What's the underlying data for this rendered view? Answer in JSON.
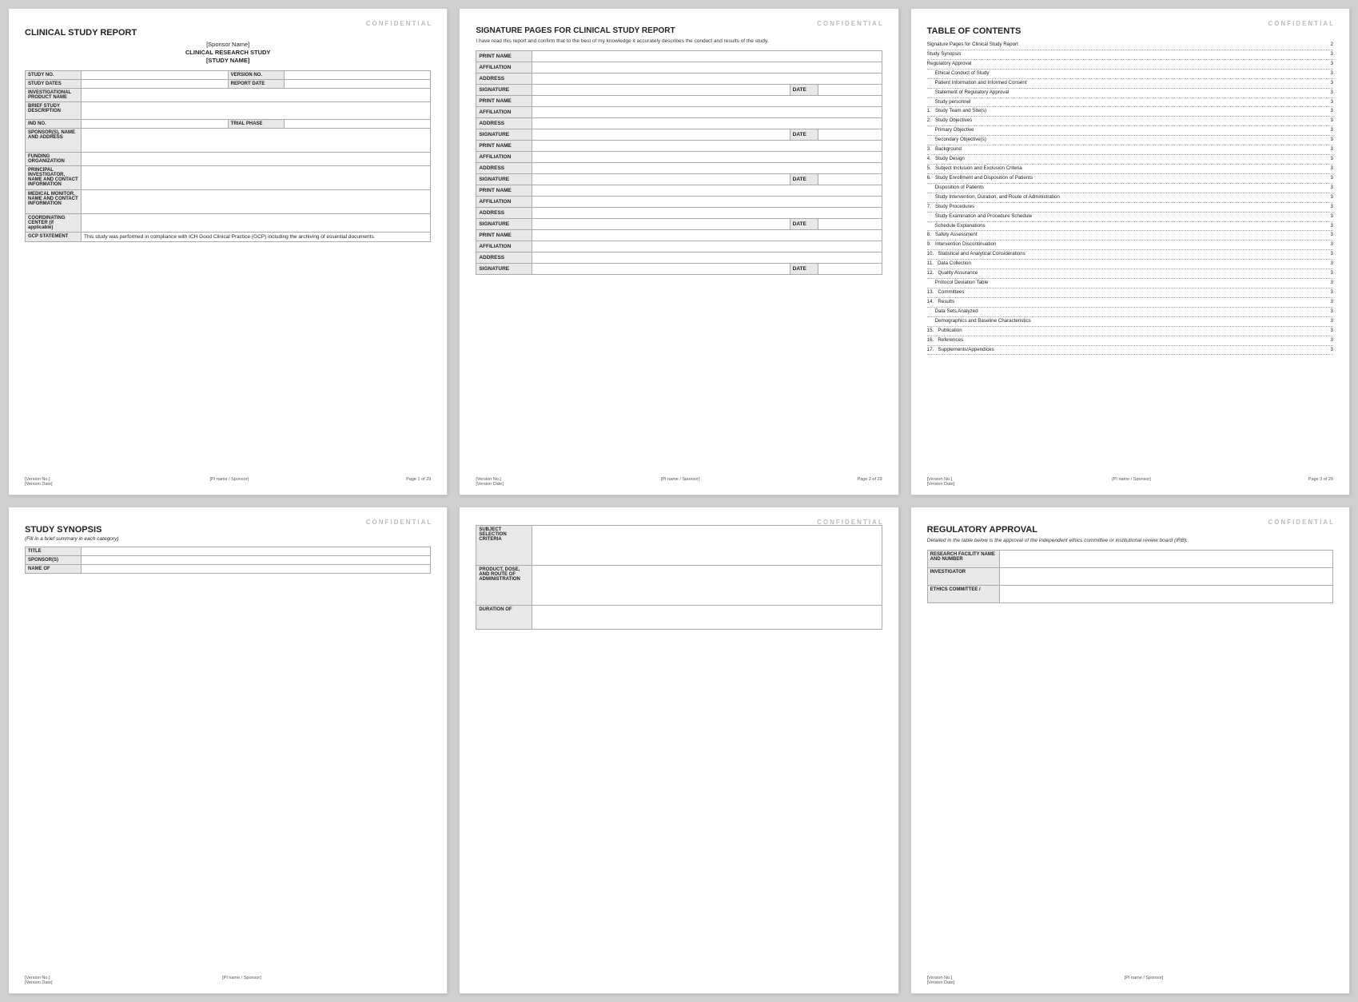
{
  "pages": [
    {
      "id": "page1",
      "confidential": "CONFIDENTIAL",
      "title": "CLINICAL STUDY REPORT",
      "subtitle1": "[Sponsor Name]",
      "subtitle2": "CLINICAL RESEARCH STUDY",
      "subtitle3": "[STUDY NAME]",
      "fields": [
        {
          "label": "STUDY NO.",
          "value": "",
          "colspan": false,
          "extra_label": "VERSION NO.",
          "extra_value": ""
        },
        {
          "label": "STUDY DATES",
          "value": "",
          "colspan": false,
          "extra_label": "REPORT DATE",
          "extra_value": ""
        },
        {
          "label": "INVESTIGATIONAL PRODUCT NAME",
          "value": "",
          "full": true
        },
        {
          "label": "BRIEF STUDY DESCRIPTION",
          "value": "",
          "full": true,
          "tall": true
        },
        {
          "label": "IND NO.",
          "value": "",
          "colspan": false,
          "extra_label": "TRIAL PHASE",
          "extra_value": ""
        },
        {
          "label": "SPONSOR(S), NAME AND ADDRESS",
          "value": "",
          "full": true,
          "taller": true
        },
        {
          "label": "FUNDING ORGANIZATION",
          "value": "",
          "full": true
        },
        {
          "label": "PRINCIPAL INVESTIGATOR, NAME AND CONTACT INFORMATION",
          "value": "",
          "full": true,
          "taller": true
        },
        {
          "label": "MEDICAL MONITOR, NAME AND CONTACT INFORMATION",
          "value": "",
          "full": true,
          "taller": true
        },
        {
          "label": "COORDINATING CENTER (if applicable)",
          "value": "",
          "full": true
        },
        {
          "label": "GCP STATEMENT",
          "value": "This study was performed in compliance with ICH Good Clinical Practice (GCP) including the archiving of essential documents.",
          "full": true
        }
      ],
      "footer": {
        "left": "[Version No.]",
        "left2": "[Version Date]",
        "center": "[PI name / Sponsor]",
        "right": "Page 1 of 29"
      }
    },
    {
      "id": "page2",
      "confidential": "CONFIDENTIAL",
      "title": "SIGNATURE PAGES FOR CLINICAL STUDY REPORT",
      "subtitle": "I have read this report and confirm that to the best of my knowledge it accurately describes the conduct and results of the study.",
      "sig_groups": [
        {
          "rows": [
            {
              "label": "PRINT NAME",
              "value": ""
            },
            {
              "label": "AFFILIATION",
              "value": ""
            },
            {
              "label": "ADDRESS",
              "value": ""
            },
            {
              "label": "SIGNATURE",
              "value": "",
              "has_date": true
            }
          ]
        },
        {
          "rows": [
            {
              "label": "PRINT NAME",
              "value": ""
            },
            {
              "label": "AFFILIATION",
              "value": ""
            },
            {
              "label": "ADDRESS",
              "value": ""
            },
            {
              "label": "SIGNATURE",
              "value": "",
              "has_date": true
            }
          ]
        },
        {
          "rows": [
            {
              "label": "PRINT NAME",
              "value": ""
            },
            {
              "label": "AFFILIATION",
              "value": ""
            },
            {
              "label": "ADDRESS",
              "value": ""
            },
            {
              "label": "SIGNATURE",
              "value": "",
              "has_date": true
            }
          ]
        },
        {
          "rows": [
            {
              "label": "PRINT NAME",
              "value": ""
            },
            {
              "label": "AFFILIATION",
              "value": ""
            },
            {
              "label": "ADDRESS",
              "value": ""
            },
            {
              "label": "SIGNATURE",
              "value": "",
              "has_date": true
            }
          ]
        },
        {
          "rows": [
            {
              "label": "PRINT NAME",
              "value": ""
            },
            {
              "label": "AFFILIATION",
              "value": ""
            },
            {
              "label": "ADDRESS",
              "value": ""
            },
            {
              "label": "SIGNATURE",
              "value": "",
              "has_date": true
            }
          ]
        }
      ],
      "footer": {
        "left": "[Version No.]",
        "left2": "[Version Date]",
        "center": "[PI name / Sponsor]",
        "right": "Page 2 of 29"
      }
    },
    {
      "id": "page3",
      "confidential": "CONFIDENTIAL",
      "title": "TABLE OF CONTENTS",
      "entries": [
        {
          "label": "Signature Pages for Clinical Study Report",
          "page": "2",
          "indent": 0
        },
        {
          "label": "Study Synopsis",
          "page": "3",
          "indent": 0
        },
        {
          "label": "Regulatory Approval",
          "page": "3",
          "indent": 0
        },
        {
          "label": "Ethical Conduct of Study",
          "page": "3",
          "indent": 1
        },
        {
          "label": "Patient Information and Informed Consent",
          "page": "3",
          "indent": 1
        },
        {
          "label": "Statement of Regulatory Approval",
          "page": "3",
          "indent": 1
        },
        {
          "label": "Study personnel",
          "page": "3",
          "indent": 1
        },
        {
          "label": "1.   Study Team and Site(s)",
          "page": "3",
          "indent": 0
        },
        {
          "label": "2.   Study Objectives",
          "page": "3",
          "indent": 0
        },
        {
          "label": "Primary Objective",
          "page": "3",
          "indent": 1
        },
        {
          "label": "Secondary Objective(s)",
          "page": "3",
          "indent": 1
        },
        {
          "label": "3.   Background",
          "page": "3",
          "indent": 0
        },
        {
          "label": "4.   Study Design",
          "page": "3",
          "indent": 0
        },
        {
          "label": "5.   Subject Inclusion and Exclusion Criteria",
          "page": "3",
          "indent": 0
        },
        {
          "label": "6.   Study Enrollment and Disposition of Patients",
          "page": "3",
          "indent": 0
        },
        {
          "label": "Disposition of Patients",
          "page": "3",
          "indent": 1
        },
        {
          "label": "Study Intervention, Duration, and Route of Administration",
          "page": "3",
          "indent": 1
        },
        {
          "label": "7.   Study Procedures",
          "page": "3",
          "indent": 0
        },
        {
          "label": "Study Examination and Procedure Schedule",
          "page": "3",
          "indent": 1
        },
        {
          "label": "Schedule Explanations",
          "page": "3",
          "indent": 1
        },
        {
          "label": "8.   Safety Assessment",
          "page": "3",
          "indent": 0
        },
        {
          "label": "9.   Intervention Discontinuation",
          "page": "3",
          "indent": 0
        },
        {
          "label": "10.   Statistical and Analytical Considerations",
          "page": "3",
          "indent": 0
        },
        {
          "label": "11.   Data Collection",
          "page": "3",
          "indent": 0
        },
        {
          "label": "12.   Quality Assurance",
          "page": "3",
          "indent": 0
        },
        {
          "label": "Protocol Deviation Table",
          "page": "3",
          "indent": 1
        },
        {
          "label": "13.   Committees",
          "page": "3",
          "indent": 0
        },
        {
          "label": "14.   Results",
          "page": "3",
          "indent": 0
        },
        {
          "label": "Data Sets Analyzed",
          "page": "3",
          "indent": 1
        },
        {
          "label": "Demographics and Baseline Characteristics",
          "page": "3",
          "indent": 1
        },
        {
          "label": "15.   Publication",
          "page": "3",
          "indent": 0
        },
        {
          "label": "16.   References",
          "page": "3",
          "indent": 0
        },
        {
          "label": "17.   Supplements/Appendices",
          "page": "3",
          "indent": 0
        }
      ],
      "footer": {
        "left": "[Version No.]",
        "left2": "[Version Date]",
        "center": "[PI name / Sponsor]",
        "right": "Page 3 of 29"
      }
    },
    {
      "id": "page4",
      "confidential": "CONFIDENTIAL",
      "title": "STUDY SYNOPSIS",
      "subtitle": "(Fill in a brief summary in each category)",
      "fields": [
        {
          "label": "TITLE",
          "value": ""
        },
        {
          "label": "SPONSOR(S)",
          "value": ""
        },
        {
          "label": "NAME OF",
          "value": ""
        }
      ],
      "footer": {
        "left": "[Version No.]",
        "left2": "[Version Date]",
        "center": "[PI name / Sponsor]",
        "right": ""
      }
    },
    {
      "id": "page5",
      "confidential": "CONFIDENTIAL",
      "fields": [
        {
          "label": "SUBJECT SELECTION CRITERIA",
          "value": "",
          "tall": true
        },
        {
          "label": "PRODUCT, DOSE, AND ROUTE OF ADMINISTRATION",
          "value": "",
          "tall": true
        },
        {
          "label": "DURATION OF",
          "value": "",
          "tall": true
        }
      ],
      "footer": {
        "left": "",
        "left2": "",
        "center": "",
        "right": ""
      }
    },
    {
      "id": "page6",
      "confidential": "CONFIDENTIAL",
      "title": "REGULATORY APPROVAL",
      "subtitle": "Detailed in the table below is the approval of the independent ethics committee or institutional review board (IRB).",
      "fields": [
        {
          "label": "RESEARCH FACILITY NAME AND NUMBER",
          "value": ""
        },
        {
          "label": "INVESTIGATOR",
          "value": ""
        },
        {
          "label": "ETHICS COMMITTEE /",
          "value": ""
        }
      ],
      "footer": {
        "left": "[Version No.]",
        "left2": "[Version Date]",
        "center": "[PI name / Sponsor]",
        "right": ""
      }
    }
  ]
}
